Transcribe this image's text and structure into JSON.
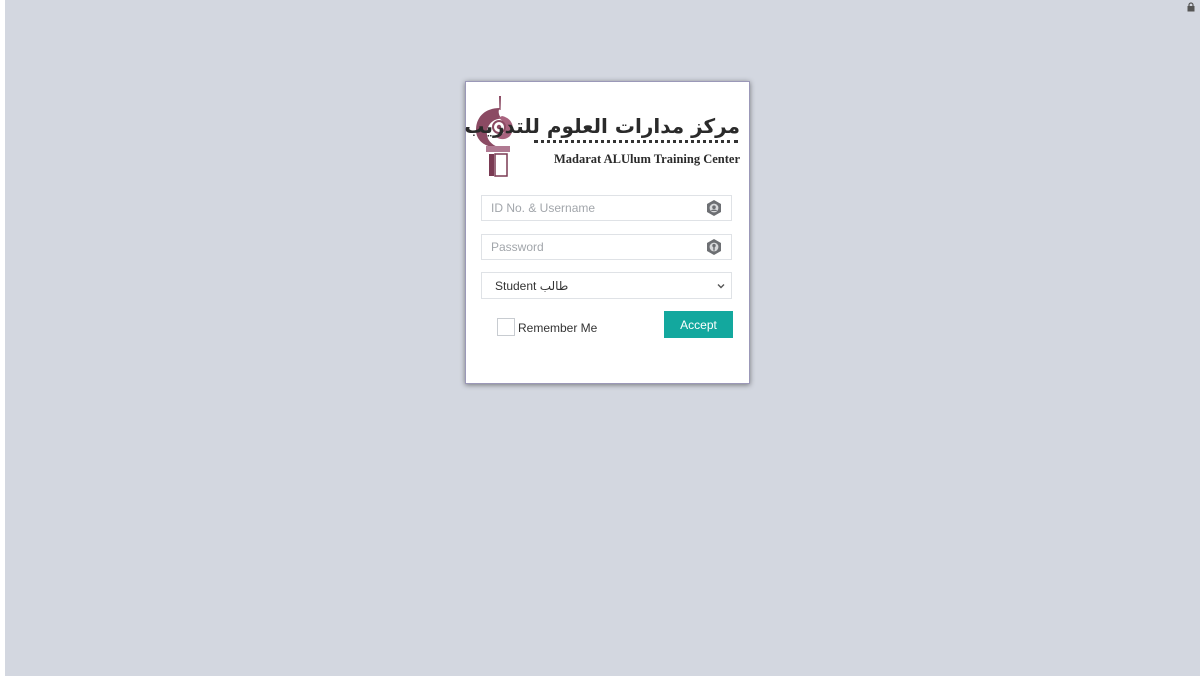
{
  "brand": {
    "name_arabic": "مركز مدارات العلوم للتدريب",
    "name_english": "Madarat ALUlum Training Center",
    "emblem_color": "#8b4a63"
  },
  "login": {
    "username": {
      "placeholder": "ID No. & Username",
      "value": ""
    },
    "password": {
      "placeholder": "Password",
      "value": ""
    },
    "role_select": {
      "selected": "Student طالب"
    },
    "remember_label": "Remember Me",
    "remember_checked": false,
    "accept_label": "Accept"
  },
  "colors": {
    "background": "#d3d7e0",
    "accent": "#13a89e"
  },
  "icons": {
    "username": "id-badge-icon",
    "password": "key-icon",
    "corner": "lock-icon"
  }
}
